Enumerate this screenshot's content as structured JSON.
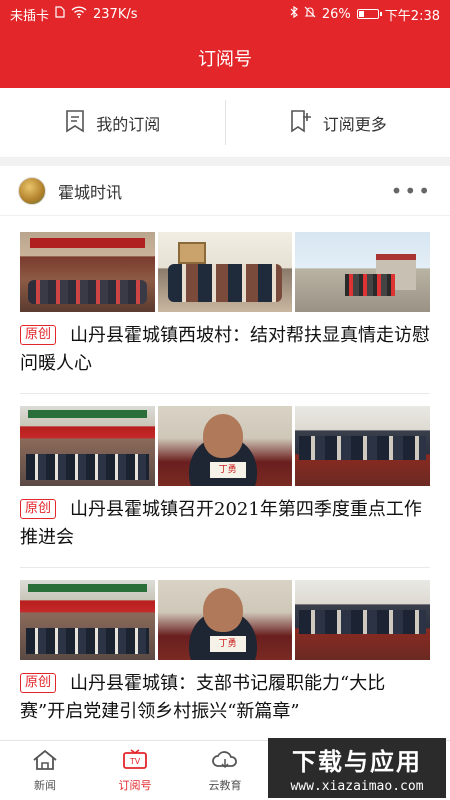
{
  "status_bar": {
    "sim": "未插卡",
    "speed": "237K/s",
    "battery": "26%",
    "battery_level": 0.26,
    "time": "下午2:38"
  },
  "title": "订阅号",
  "tabs": {
    "my_subscriptions": "我的订阅",
    "subscribe_more": "订阅更多"
  },
  "channel": {
    "name": "霍城时讯"
  },
  "articles": [
    {
      "tag": "原创",
      "title": "山丹县霍城镇西坡村：结对帮扶显真情走访慰问暖人心"
    },
    {
      "tag": "原创",
      "title": "山丹县霍城镇召开2021年第四季度重点工作推进会"
    },
    {
      "tag": "原创",
      "title": "山丹县霍城镇：支部书记履职能力“大比赛”开启党建引领乡村振兴“新篇章”"
    }
  ],
  "bottom_nav": {
    "news": "新闻",
    "subscription": "订阅号",
    "cloud_education": "云教育"
  },
  "watermark": {
    "line1": "下载与应用",
    "line2": "www.xiazaimao.com"
  },
  "colors": {
    "brand_red": "#e3262a"
  }
}
